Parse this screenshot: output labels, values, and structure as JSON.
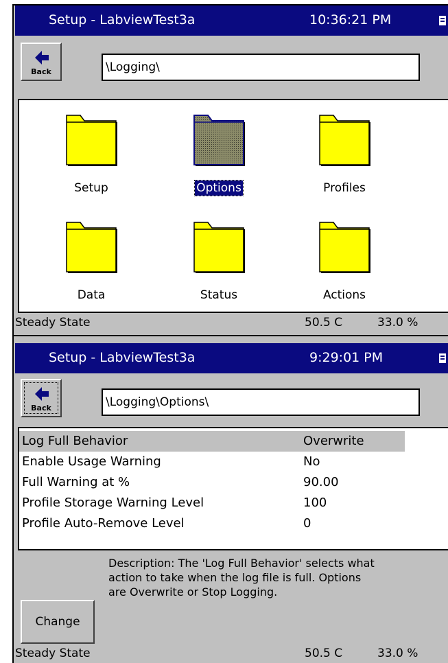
{
  "screen1": {
    "title": "Setup - LabviewTest3a",
    "time": "10:36:21 PM",
    "back_label": "Back",
    "path": "\\Logging\\",
    "folders": [
      {
        "label": "Setup",
        "selected": false
      },
      {
        "label": "Options",
        "selected": true
      },
      {
        "label": "Profiles",
        "selected": false
      },
      {
        "label": "Data",
        "selected": false
      },
      {
        "label": "Status",
        "selected": false
      },
      {
        "label": "Actions",
        "selected": false
      }
    ],
    "status": {
      "state": "Steady State",
      "temperature": "50.5 C",
      "humidity": "33.0 %"
    }
  },
  "screen2": {
    "title": "Setup - LabviewTest3a",
    "time": "9:29:01 PM",
    "back_label": "Back",
    "path": "\\Logging\\Options\\",
    "options": [
      {
        "name": "Log Full Behavior",
        "value": "Overwrite",
        "selected": true
      },
      {
        "name": "Enable Usage Warning",
        "value": "No",
        "selected": false
      },
      {
        "name": "Full Warning at %",
        "value": "90.00",
        "selected": false
      },
      {
        "name": "Profile Storage Warning Level",
        "value": "100",
        "selected": false
      },
      {
        "name": "Profile Auto-Remove Level",
        "value": "0",
        "selected": false
      }
    ],
    "description_lines": [
      "Description:  The 'Log Full Behavior' selects what",
      "action to take when the log file is full.  Options",
      "are Overwrite or Stop Logging."
    ],
    "change_label": "Change",
    "status": {
      "state": "Steady State",
      "temperature": "50.5 C",
      "humidity": "33.0 %"
    }
  },
  "colors": {
    "titlebar": "#0a0a80",
    "folder": "#ffff00",
    "selected_folder": "#8a8a68",
    "selection_bg": "#c0c0c0"
  },
  "icons": {
    "back": "back-arrow-icon",
    "folder": "folder-icon",
    "menu": "menu-icon"
  }
}
